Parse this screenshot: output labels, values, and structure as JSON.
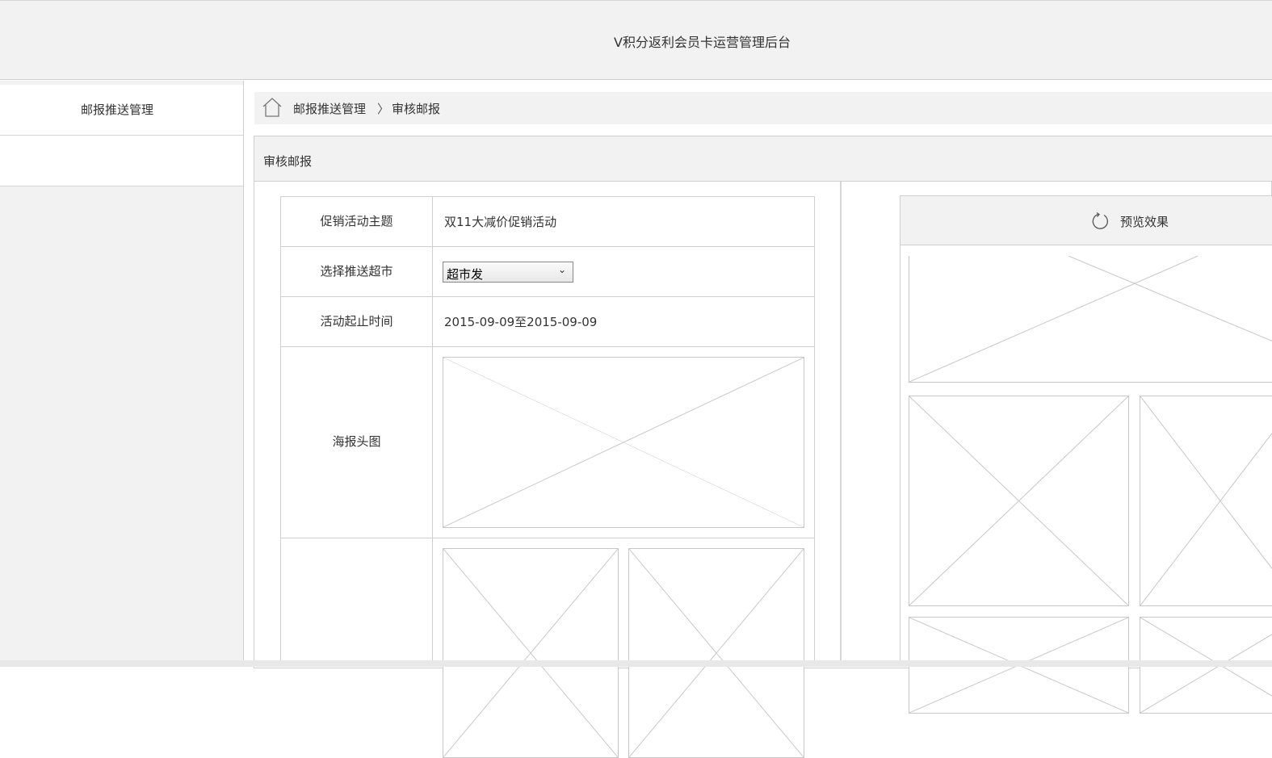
{
  "header": {
    "title": "V积分返利会员卡运营管理后台"
  },
  "sidebar": {
    "items": [
      {
        "label": "邮报推送管理"
      },
      {
        "label": ""
      }
    ]
  },
  "breadcrumb": {
    "home_icon": "home-icon",
    "parent": "邮报推送管理",
    "separator": "〉",
    "current": "审核邮报"
  },
  "panel": {
    "title": "审核邮报"
  },
  "form": {
    "rows": [
      {
        "label": "促销活动主题",
        "value": "双11大减价促销活动"
      },
      {
        "label": "选择推送超市",
        "value": "超市发"
      },
      {
        "label": "活动起止时间",
        "value": "2015-09-09至2015-09-09"
      },
      {
        "label": "海报头图"
      },
      {
        "label": ""
      }
    ]
  },
  "preview": {
    "label": "预览效果",
    "icon": "refresh-icon"
  },
  "colors": {
    "header_bg": "#f2f2f2",
    "border": "#cfcfcf",
    "placeholder_line": "#c8c8c8"
  }
}
